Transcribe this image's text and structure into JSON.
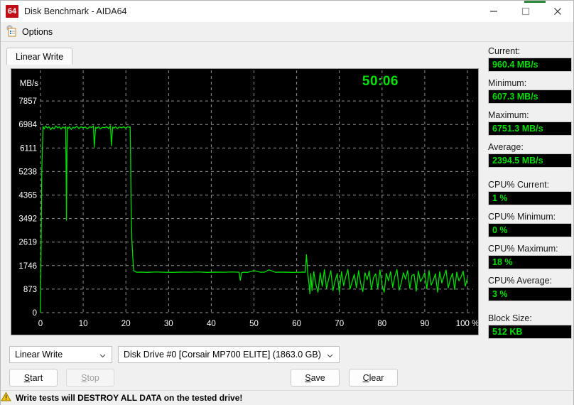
{
  "window": {
    "title": "Disk Benchmark - AIDA64",
    "icon_label": "64",
    "icon_name": "aida64-icon",
    "minimize_icon": "minimize-icon",
    "maximize_icon": "maximize-icon",
    "close_icon": "close-icon",
    "accent_color": "#2e8b3d"
  },
  "menubar": {
    "options_label": "Options",
    "options_icon": "options-gear-icon"
  },
  "tabs": [
    {
      "label": "Linear Write",
      "active": true
    }
  ],
  "plot": {
    "timer": "50:06",
    "y_axis_unit": "MB/s",
    "x_axis_unit": "%",
    "trace_color": "#00dd00",
    "grid_color": "#9a9a9a",
    "background": "#000000"
  },
  "controls": {
    "test_type": "Linear Write",
    "drive": "Disk Drive #0  [Corsair MP700 ELITE]  (1863.0 GB)",
    "start_label": "Start",
    "start_mnemonic": "S",
    "stop_label": "Stop",
    "stop_mnemonic": "S",
    "save_label": "Save",
    "save_mnemonic": "S",
    "clear_label": "Clear",
    "clear_mnemonic": "C",
    "stop_disabled": true
  },
  "statusbar": {
    "warning_icon": "warning-triangle-icon",
    "text": "Write tests will DESTROY ALL DATA on the tested drive!"
  },
  "stats": [
    {
      "label": "Current:",
      "value": "960.4 MB/s"
    },
    {
      "label": "Minimum:",
      "value": "607.3 MB/s"
    },
    {
      "label": "Maximum:",
      "value": "6751.3 MB/s"
    },
    {
      "label": "Average:",
      "value": "2394.5 MB/s"
    },
    {
      "label": "CPU% Current:",
      "value": "1 %",
      "gap_before": true
    },
    {
      "label": "CPU% Minimum:",
      "value": "0 %"
    },
    {
      "label": "CPU% Maximum:",
      "value": "18 %"
    },
    {
      "label": "CPU% Average:",
      "value": "3 %"
    },
    {
      "label": "Block Size:",
      "value": "512 KB",
      "gap_before": true
    }
  ],
  "chart_data": {
    "type": "line",
    "title": "Linear Write",
    "xlabel": "%",
    "ylabel": "MB/s",
    "xlim": [
      0,
      100
    ],
    "ylim": [
      0,
      8730
    ],
    "grid": true,
    "legend": null,
    "yticks": [
      0,
      873,
      1746,
      2619,
      3492,
      4365,
      5238,
      6111,
      6984,
      7857
    ],
    "xticks": [
      0,
      10,
      20,
      30,
      40,
      50,
      60,
      70,
      80,
      90,
      100
    ],
    "xtick_labels": [
      "0",
      "10",
      "20",
      "30",
      "40",
      "50",
      "60",
      "70",
      "80",
      "90",
      "100 %"
    ],
    "series": [
      {
        "name": "Linear Write speed",
        "color": "#00dd00",
        "description": "SLC-cache plateau near 6900 MB/s to ~21%, then folded-cache plateau near 1500 MB/s to ~62%, then noisy native-TLC region averaging ~1150 MB/s",
        "x": [
          0.0,
          0.3,
          0.6,
          0.9,
          1.2,
          1.6,
          2.0,
          2.4,
          2.8,
          3.2,
          3.6,
          4.0,
          4.4,
          4.8,
          5.2,
          5.6,
          5.9,
          6.0,
          6.1,
          6.2,
          6.3,
          6.5,
          6.8,
          7.2,
          7.6,
          8.0,
          8.5,
          9.0,
          9.5,
          10.0,
          10.5,
          11.0,
          11.5,
          12.0,
          12.4,
          12.6,
          12.9,
          13.2,
          13.6,
          14.0,
          14.5,
          15.0,
          15.5,
          16.0,
          16.4,
          16.6,
          16.9,
          17.2,
          17.6,
          18.0,
          18.5,
          19.0,
          19.5,
          20.0,
          20.4,
          20.8,
          21.0,
          21.1,
          21.2,
          21.4,
          21.8,
          22.5,
          23.5,
          25.0,
          27.0,
          29.0,
          31.0,
          33.0,
          35.0,
          37.0,
          39.0,
          41.0,
          43.0,
          45.0,
          46.5,
          46.8,
          47.1,
          47.5,
          48.5,
          50.0,
          51.5,
          52.5,
          53.5,
          55.0,
          57.0,
          59.0,
          60.5,
          61.5,
          62.0,
          62.3,
          62.6,
          62.9,
          63.1,
          63.3,
          63.6,
          64.0,
          64.5,
          65.0,
          65.5,
          66.0,
          66.5,
          67.0,
          67.5,
          68.0,
          68.5,
          69.0,
          69.5,
          70.0,
          70.5,
          71.0,
          71.5,
          72.0,
          72.5,
          73.0,
          73.5,
          74.0,
          74.5,
          75.0,
          75.5,
          76.0,
          76.5,
          77.0,
          77.5,
          78.0,
          78.5,
          79.0,
          79.5,
          80.0,
          80.5,
          81.0,
          81.5,
          82.0,
          82.5,
          83.0,
          83.5,
          84.0,
          84.5,
          85.0,
          85.5,
          86.0,
          86.5,
          87.0,
          87.5,
          88.0,
          88.5,
          89.0,
          89.5,
          90.0,
          90.5,
          91.0,
          91.5,
          92.0,
          92.5,
          93.0,
          93.5,
          94.0,
          94.5,
          95.0,
          95.5,
          96.0,
          96.5,
          97.0,
          97.5,
          98.0,
          98.5,
          99.0,
          99.5,
          100.0
        ],
        "y": [
          0,
          5240,
          6900,
          6820,
          6930,
          6850,
          6900,
          6790,
          6880,
          6820,
          6930,
          6860,
          6900,
          6810,
          6890,
          6850,
          6900,
          5240,
          3430,
          6000,
          6880,
          6840,
          6900,
          6800,
          6880,
          6850,
          6920,
          6830,
          6900,
          6860,
          6890,
          6820,
          6900,
          6870,
          6930,
          6150,
          6880,
          6840,
          6900,
          6820,
          6880,
          6860,
          6900,
          6830,
          6940,
          6200,
          6890,
          6850,
          6900,
          6830,
          6890,
          6860,
          6900,
          6840,
          6900,
          6880,
          6900,
          5900,
          4200,
          2700,
          1560,
          1500,
          1505,
          1495,
          1510,
          1500,
          1495,
          1505,
          1500,
          1510,
          1495,
          1505,
          1500,
          1510,
          1500,
          1200,
          1480,
          1500,
          1495,
          1560,
          1500,
          1505,
          1590,
          1500,
          1505,
          1495,
          1500,
          1505,
          1500,
          2150,
          1450,
          1050,
          700,
          1450,
          820,
          1520,
          1050,
          760,
          1480,
          980,
          1600,
          900,
          1250,
          1560,
          820,
          1180,
          1450,
          760,
          1520,
          1000,
          1340,
          1600,
          880,
          1150,
          1420,
          920,
          1560,
          1080,
          780,
          1480,
          1220,
          1550,
          860,
          1300,
          1440,
          900,
          1580,
          1020,
          760,
          1460,
          1180,
          1520,
          940,
          1350,
          1600,
          840,
          1100,
          1480,
          1240,
          1560,
          900,
          1380,
          1420,
          800,
          1540,
          1150,
          1300,
          1480,
          880,
          1560,
          1020,
          1200,
          1440,
          760,
          1520,
          1100,
          1350,
          1580,
          920,
          1240,
          1460,
          860,
          1500,
          1180,
          1320,
          1540,
          980,
          1280,
          1420,
          840,
          1560,
          1160,
          1400
        ]
      }
    ]
  }
}
